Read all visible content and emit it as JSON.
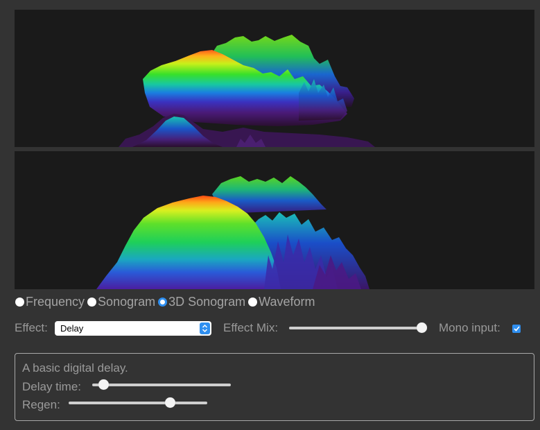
{
  "modes": [
    {
      "label": "Frequency",
      "checked": false
    },
    {
      "label": "Sonogram",
      "checked": false
    },
    {
      "label": "3D Sonogram",
      "checked": true
    },
    {
      "label": "Waveform",
      "checked": false
    }
  ],
  "effect": {
    "label": "Effect:",
    "selected": "Delay"
  },
  "effect_mix": {
    "label": "Effect Mix:",
    "value": 0.97
  },
  "mono_input": {
    "label": "Mono input:",
    "checked": true
  },
  "effect_panel": {
    "description": "A basic digital delay.",
    "delay_time_label": "Delay time:",
    "delay_time_value": 0.08,
    "regen_label": "Regen:",
    "regen_value": 0.73
  },
  "colors": {
    "accent": "#2f8ff0",
    "background": "#333333",
    "canvas": "#1a1a1a"
  }
}
